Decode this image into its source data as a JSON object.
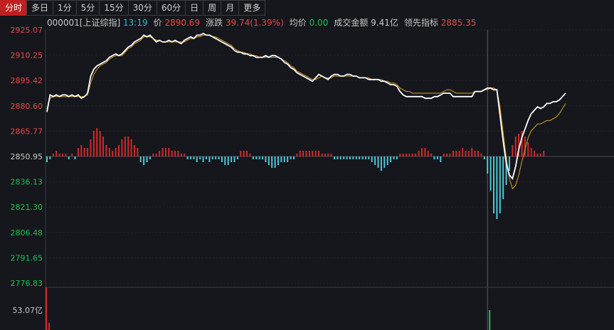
{
  "tabs": [
    {
      "label": "分时",
      "active": true
    },
    {
      "label": "多日",
      "active": false
    },
    {
      "label": "1分",
      "active": false
    },
    {
      "label": "5分",
      "active": false
    },
    {
      "label": "15分",
      "active": false
    },
    {
      "label": "30分",
      "active": false
    },
    {
      "label": "60分",
      "active": false
    },
    {
      "label": "日",
      "active": false
    },
    {
      "label": "周",
      "active": false
    },
    {
      "label": "月",
      "active": false
    },
    {
      "label": "更多",
      "active": false
    }
  ],
  "info": {
    "code": "000001[上证综指]",
    "time": "13:19",
    "price_label": "价",
    "price": "2890.69",
    "change_label": "涨跌",
    "change": "39.74(1.39%)",
    "avg_label": "均价",
    "avg": "0.00",
    "amount_label": "成交金额",
    "amount": "9.41亿",
    "lead_label": "领先指标",
    "lead": "2885.35"
  },
  "colors": {
    "up": "#e84848",
    "down": "#1fbf4f",
    "flat": "#c8c8c8",
    "price_line": "#ffffff",
    "lead_line": "#e0a020",
    "bar_up": "#d42a2a",
    "bar_down": "#4fc8d8"
  },
  "chart_data": {
    "type": "line",
    "y_tick_labels": [
      "2925.07",
      "2910.25",
      "2895.42",
      "2880.60",
      "2865.77",
      "2850.95",
      "2836.13",
      "2821.30",
      "2806.48",
      "2791.65",
      "2776.83"
    ],
    "prev_close": 2850.95,
    "ylim": [
      2776.83,
      2925.07
    ],
    "volume_label": "53.07亿",
    "series": [
      {
        "values": [
          2877,
          2887,
          2886,
          2887,
          2886,
          2887,
          2887,
          2886,
          2887,
          2886,
          2887,
          2885,
          2886,
          2888,
          2898,
          2902,
          2904,
          2905,
          2906,
          2907,
          2909,
          2910,
          2911,
          2910,
          2911,
          2913,
          2915,
          2916,
          2918,
          2919,
          2920,
          2922,
          2921,
          2922,
          2920,
          2918,
          2919,
          2918,
          2918,
          2919,
          2918,
          2919,
          2918,
          2917,
          2919,
          2920,
          2921,
          2920,
          2922,
          2922,
          2923,
          2922,
          2922,
          2921,
          2920,
          2919,
          2918,
          2917,
          2916,
          2915,
          2913,
          2912,
          2912,
          2911,
          2911,
          2910,
          2910,
          2909,
          2909,
          2909,
          2910,
          2909,
          2910,
          2910,
          2909,
          2908,
          2906,
          2905,
          2903,
          2902,
          2900,
          2899,
          2898,
          2897,
          2896,
          2895,
          2897,
          2899,
          2898,
          2897,
          2896,
          2898,
          2899,
          2899,
          2898,
          2898,
          2899,
          2899,
          2898,
          2898,
          2897,
          2897,
          2897,
          2896,
          2896,
          2896,
          2896,
          2895,
          2895,
          2894,
          2893,
          2893,
          2892,
          2889,
          2887,
          2886,
          2886,
          2886,
          2886,
          2886,
          2886,
          2885,
          2885,
          2885,
          2886,
          2886,
          2887,
          2888,
          2888,
          2888,
          2886,
          2886,
          2886,
          2886,
          2886,
          2886,
          2886,
          2889,
          2889,
          2889,
          2890,
          2891,
          2891,
          2890,
          2890,
          2875,
          2860,
          2847,
          2840,
          2838,
          2845,
          2855,
          2862,
          2867,
          2872,
          2876,
          2878,
          2880,
          2879,
          2880,
          2882,
          2882,
          2883,
          2883,
          2884,
          2886,
          2888
        ]
      },
      {
        "values": [
          2879,
          2885,
          2886,
          2886,
          2886,
          2886,
          2886,
          2886,
          2886,
          2886,
          2886,
          2886,
          2886,
          2887,
          2894,
          2899,
          2902,
          2904,
          2905,
          2906,
          2908,
          2909,
          2910,
          2910,
          2910,
          2912,
          2914,
          2915,
          2917,
          2918,
          2919,
          2921,
          2921,
          2921,
          2920,
          2919,
          2919,
          2918,
          2918,
          2918,
          2918,
          2918,
          2918,
          2918,
          2918,
          2919,
          2920,
          2920,
          2921,
          2921,
          2922,
          2922,
          2922,
          2921,
          2921,
          2920,
          2919,
          2918,
          2917,
          2916,
          2914,
          2913,
          2912,
          2912,
          2911,
          2911,
          2910,
          2910,
          2909,
          2909,
          2909,
          2909,
          2909,
          2909,
          2909,
          2908,
          2907,
          2906,
          2904,
          2903,
          2901,
          2900,
          2899,
          2898,
          2897,
          2896,
          2896,
          2897,
          2898,
          2897,
          2897,
          2897,
          2898,
          2898,
          2898,
          2898,
          2898,
          2898,
          2898,
          2898,
          2897,
          2897,
          2897,
          2897,
          2896,
          2896,
          2896,
          2896,
          2895,
          2895,
          2894,
          2894,
          2893,
          2891,
          2890,
          2889,
          2889,
          2888,
          2888,
          2888,
          2888,
          2888,
          2888,
          2888,
          2888,
          2888,
          2888,
          2889,
          2890,
          2890,
          2889,
          2888,
          2888,
          2888,
          2888,
          2888,
          2888,
          2889,
          2889,
          2889,
          2890,
          2890,
          2891,
          2891,
          2890,
          2880,
          2865,
          2850,
          2838,
          2832,
          2834,
          2840,
          2848,
          2855,
          2862,
          2866,
          2868,
          2870,
          2870,
          2871,
          2872,
          2872,
          2873,
          2874,
          2876,
          2879,
          2882
        ]
      }
    ],
    "volume_bars": [
      -2,
      -1,
      1,
      2,
      1,
      1,
      1,
      -1,
      1,
      -1,
      3,
      4,
      3,
      3,
      6,
      9,
      10,
      9,
      7,
      4,
      3,
      2,
      3,
      4,
      6,
      7,
      7,
      6,
      4,
      3,
      -2,
      -3,
      -2,
      -1,
      1,
      1,
      2,
      3,
      3,
      3,
      2,
      2,
      2,
      1,
      1,
      -1,
      -1,
      -1,
      -2,
      -1,
      -2,
      -1,
      -2,
      -1,
      -1,
      -1,
      -2,
      -3,
      -3,
      -2,
      -2,
      -1,
      2,
      2,
      2,
      1,
      -1,
      -1,
      -1,
      -1,
      -2,
      -3,
      -4,
      -4,
      -3,
      -2,
      -2,
      -2,
      -1,
      -1,
      1,
      2,
      2,
      2,
      2,
      2,
      2,
      2,
      1,
      1,
      1,
      1,
      -1,
      -1,
      -1,
      -1,
      -1,
      -1,
      -1,
      -1,
      -1,
      -1,
      -1,
      -1,
      -2,
      -3,
      -4,
      -5,
      -4,
      -3,
      -2,
      -1,
      -1,
      1,
      1,
      1,
      1,
      1,
      1,
      2,
      3,
      3,
      2,
      1,
      -1,
      -1,
      -2,
      1,
      1,
      1,
      2,
      2,
      2,
      3,
      2,
      2,
      3,
      2,
      2,
      1,
      -1,
      -6,
      -12,
      -20,
      -22,
      -20,
      -15,
      -10,
      -5,
      4,
      7,
      8,
      9,
      7,
      5,
      3,
      2,
      1,
      1,
      2
    ],
    "vline_index": 141
  }
}
